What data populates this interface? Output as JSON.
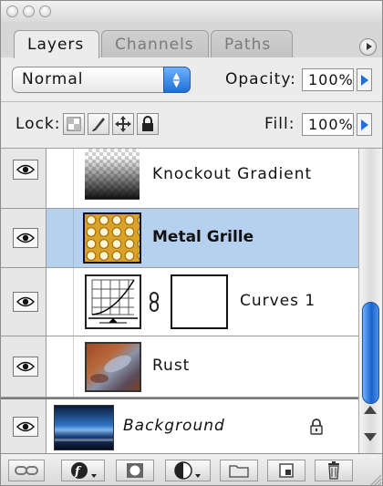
{
  "window": {
    "buttons": [
      "close",
      "minimize",
      "zoom"
    ]
  },
  "tabs": [
    {
      "label": "Layers",
      "active": true
    },
    {
      "label": "Channels",
      "active": false
    },
    {
      "label": "Paths",
      "active": false
    }
  ],
  "blend": {
    "mode": "Normal",
    "opacity_label": "Opacity:",
    "opacity_value": "100%"
  },
  "lock": {
    "label": "Lock:",
    "fill_label": "Fill:",
    "fill_value": "100%"
  },
  "layers": [
    {
      "name": "Knockout Gradient",
      "selected": false,
      "thumb": "gradient"
    },
    {
      "name": "Metal Grille",
      "selected": true,
      "thumb": "grille"
    },
    {
      "name": "Curves 1",
      "selected": false,
      "thumb": "curves"
    },
    {
      "name": "Rust",
      "selected": false,
      "thumb": "rust"
    },
    {
      "name": "Background",
      "selected": false,
      "thumb": "background",
      "locked": true
    }
  ],
  "icons": {
    "eye": "eye-icon",
    "link": "chain-link-icon",
    "lock": "padlock-icon",
    "bottom": [
      "link-layers-icon",
      "layer-style-icon",
      "layer-mask-icon",
      "adjustment-layer-icon",
      "new-group-icon",
      "new-layer-icon",
      "trash-icon"
    ]
  },
  "colors": {
    "selection": "#b6d0ef",
    "accent": "#1d6fd6"
  }
}
